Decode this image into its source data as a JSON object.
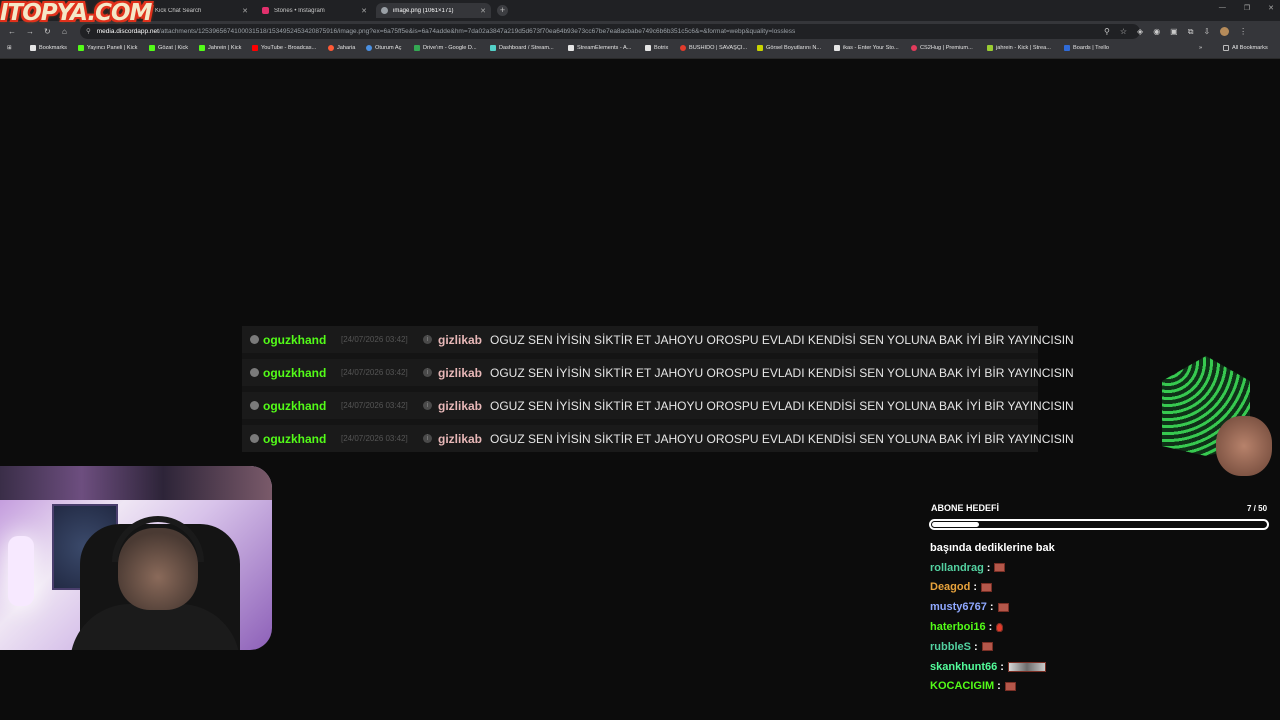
{
  "browser": {
    "tabs": [
      {
        "title": "Kick Chat Search",
        "active": false,
        "favicon_color": "#53fc18"
      },
      {
        "title": "Stories • Instagram",
        "active": false,
        "favicon_color": "#e1306c"
      },
      {
        "title": "image.png (1061×171)",
        "active": true,
        "favicon_color": "#9aa0a6"
      }
    ],
    "new_tab_label": "+",
    "url_host": "media.discordapp.net",
    "url_path": "/attachments/1253965674100031518/1534952453420875916/image.png?ex=6a75ff5e&is=6a74adde&hm=7da02a3847a219d5d673f70ea64b93e73cc67be7ea8acbabe749c6b6b351c5c6&=&format=webp&quality=lossless",
    "bookmarks": [
      {
        "label": "Bookmarks",
        "icon": "star-icon",
        "color": "#e5e5e5"
      },
      {
        "label": "Yayıncı Paneli | Kick",
        "icon": "kick-icon",
        "color": "#53fc18"
      },
      {
        "label": "Gözat | Kick",
        "icon": "kick-icon",
        "color": "#53fc18"
      },
      {
        "label": "Jahrein | Kick",
        "icon": "kick-icon",
        "color": "#53fc18"
      },
      {
        "label": "YouTube - Broadcas...",
        "icon": "youtube-icon",
        "color": "#ff0000"
      },
      {
        "label": "Jaharia",
        "icon": "circle-icon",
        "color": "#ff5a36"
      },
      {
        "label": "Oturum Aç",
        "icon": "circle-icon",
        "color": "#4a90e2"
      },
      {
        "label": "Drive'ım - Google D...",
        "icon": "drive-icon",
        "color": "#34a853"
      },
      {
        "label": "Dashboard / Stream...",
        "icon": "dashboard-icon",
        "color": "#53d1c8"
      },
      {
        "label": "StreamElements - A...",
        "icon": "streamelements-icon",
        "color": "#e5e5e5"
      },
      {
        "label": "Botrix",
        "icon": "diamond-icon",
        "color": "#e5e5e5"
      },
      {
        "label": "BUSHIDO | SAVAŞÇI...",
        "icon": "circle-icon",
        "color": "#e23b2b"
      },
      {
        "label": "Görsel Boyutlarını N...",
        "icon": "pen-icon",
        "color": "#c8d400"
      },
      {
        "label": "ikas - Enter Your Sto...",
        "icon": "pen-icon",
        "color": "#e5e5e5"
      },
      {
        "label": "CS2Hug | Premium...",
        "icon": "circle-icon",
        "color": "#e23b5b"
      },
      {
        "label": "jahrein - Kick | Strea...",
        "icon": "chart-icon",
        "color": "#9acd32"
      },
      {
        "label": "Boards | Trello",
        "icon": "trello-icon",
        "color": "#2f6bd8"
      }
    ],
    "all_bookmarks_label": "All Bookmarks"
  },
  "logo_text": "ITOPYA.COM",
  "chat_overlay": {
    "rows": [
      {
        "user": "oguzkhand",
        "timestamp": "[24/07/2026 03:42]",
        "target": "gizlikab",
        "message": "OGUZ SEN İYİSİN SİKTİR ET JAHOYU OROSPU EVLADI KENDİSİ SEN YOLUNA BAK İYİ BİR YAYINCISIN"
      },
      {
        "user": "oguzkhand",
        "timestamp": "[24/07/2026 03:42]",
        "target": "gizlikab",
        "message": "OGUZ SEN İYİSİN SİKTİR ET JAHOYU OROSPU EVLADI KENDİSİ SEN YOLUNA BAK İYİ BİR YAYINCISIN"
      },
      {
        "user": "oguzkhand",
        "timestamp": "[24/07/2026 03:42]",
        "target": "gizlikab",
        "message": "OGUZ SEN İYİSİN SİKTİR ET JAHOYU OROSPU EVLADI KENDİSİ SEN YOLUNA BAK İYİ BİR YAYINCISIN"
      },
      {
        "user": "oguzkhand",
        "timestamp": "[24/07/2026 03:42]",
        "target": "gizlikab",
        "message": "OGUZ SEN İYİSİN SİKTİR ET JAHOYU OROSPU EVLADI KENDİSİ SEN YOLUNA BAK İYİ BİR YAYINCISIN"
      }
    ]
  },
  "sub_goal": {
    "label": "ABONE HEDEFİ",
    "current": 7,
    "target": 50,
    "count_text": "7 / 50"
  },
  "side_chat": {
    "lines": [
      {
        "text": "başında dediklerine bak",
        "user": null,
        "color": "#ffffff",
        "emote": null
      },
      {
        "user": "rollandrag",
        "color": "#53d1a0",
        "emote": "brick"
      },
      {
        "user": "Deagod",
        "color": "#e8a33c",
        "emote": "brick"
      },
      {
        "user": "musty6767",
        "color": "#8fa8ff",
        "emote": "brick"
      },
      {
        "user": "haterboi16",
        "color": "#53fc18",
        "emote": "red"
      },
      {
        "user": "rubbleS",
        "color": "#53d1a0",
        "emote": "brick"
      },
      {
        "user": "skankhunt66",
        "color": "#53fc9a",
        "emote": "wide"
      },
      {
        "user": "KOCACIGIM",
        "color": "#53fc18",
        "emote": "brick"
      }
    ],
    "separator": ":"
  }
}
